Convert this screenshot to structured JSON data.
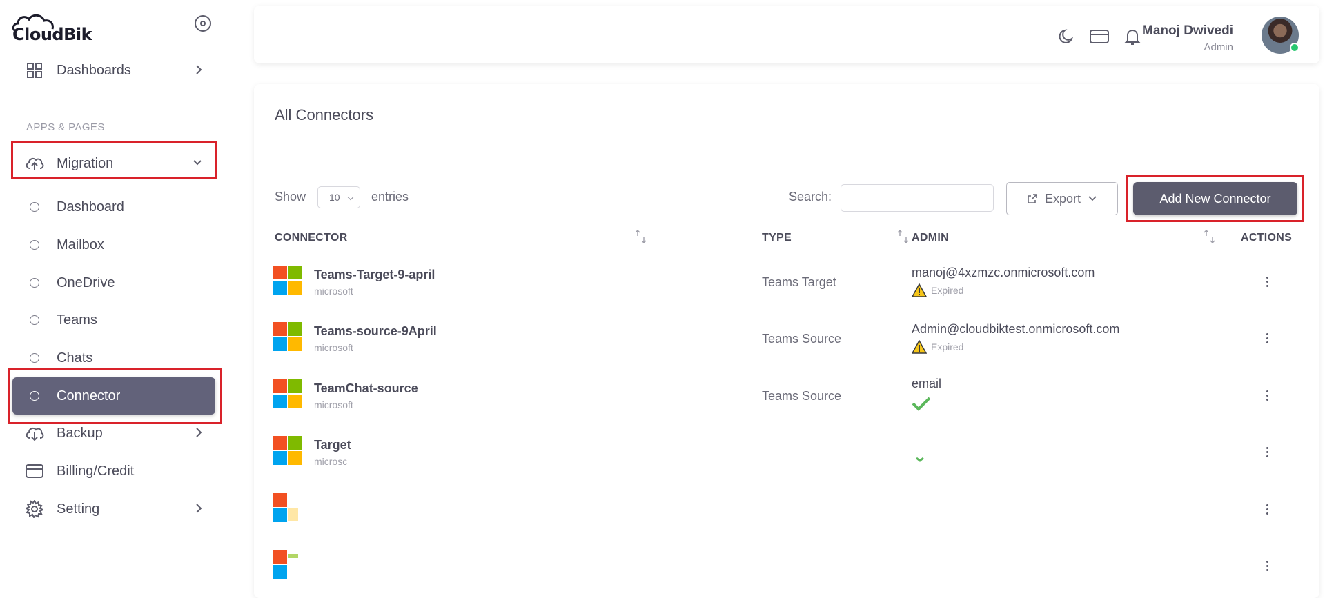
{
  "app": {
    "logo_text": "CloudBik"
  },
  "sidebar": {
    "dashboards_label": "Dashboards",
    "section_label": "APPS & PAGES",
    "migration_label": "Migration",
    "migration_items": [
      {
        "label": "Dashboard"
      },
      {
        "label": "Mailbox"
      },
      {
        "label": "OneDrive"
      },
      {
        "label": "Teams"
      },
      {
        "label": "Chats"
      },
      {
        "label": "Connector",
        "active": true
      }
    ],
    "backup_label": "Backup",
    "billing_label": "Billing/Credit",
    "setting_label": "Setting"
  },
  "header": {
    "user_name": "Manoj Dwivedi",
    "user_role": "Admin"
  },
  "main": {
    "title": "All Connectors",
    "show_label": "Show",
    "page_size": "10",
    "entries_label": "entries",
    "search_label": "Search:",
    "search_value": "",
    "export_label": "Export",
    "add_button_label": "Add New Connector",
    "columns": {
      "connector": "CONNECTOR",
      "type": "TYPE",
      "admin": "ADMIN",
      "actions": "ACTIONS"
    },
    "rows": [
      {
        "name": "Teams-Target-9-april",
        "provider": "microsoft",
        "type": "Teams Target",
        "admin": "manoj@4xzmzc.onmicrosoft.com",
        "status": "Expired"
      },
      {
        "name": "Teams-source-9April",
        "provider": "microsoft",
        "type": "Teams Source",
        "admin": "Admin@cloudbiktest.onmicrosoft.com",
        "status": "Expired"
      },
      {
        "name": "TeamChat-source",
        "provider": "microsoft",
        "type": "Teams Source",
        "admin": "email",
        "status": "valid"
      },
      {
        "name": "Target",
        "provider": "microsc",
        "type": "",
        "admin": "",
        "status": ""
      },
      {
        "name": "",
        "provider": "",
        "type": "",
        "admin": "",
        "status": ""
      },
      {
        "name": "",
        "provider": "",
        "type": "",
        "admin": "",
        "status": ""
      }
    ]
  },
  "icons": {
    "dashboards": "grid-icon",
    "migration": "cloud-upload-icon",
    "backup": "cloud-download-icon",
    "billing": "credit-card-icon",
    "setting": "gear-icon",
    "theme": "moon-icon",
    "wallet": "card-icon",
    "notifications": "bell-icon"
  },
  "colors": {
    "active_bg": "#62627a",
    "primary_button": "#5c5c6e",
    "highlight": "#d9222a",
    "warning": "#f5c518",
    "success": "#5cb85c"
  }
}
